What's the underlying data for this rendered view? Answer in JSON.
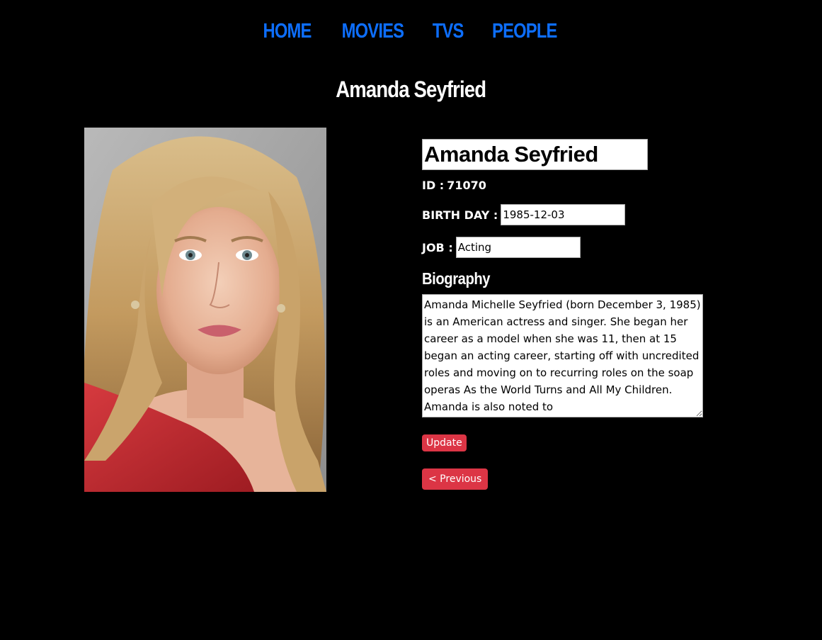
{
  "nav": {
    "items": [
      {
        "label": "HOME"
      },
      {
        "label": "MOVIES"
      },
      {
        "label": "TVS"
      },
      {
        "label": "PEOPLE"
      }
    ],
    "color": "#0d6efd"
  },
  "page_title": "Amanda Seyfried",
  "photo": {
    "alt": "Amanda Seyfried portrait"
  },
  "person": {
    "name": "Amanda Seyfried",
    "id_label": "ID :",
    "id_value": "71070",
    "birthday_label": "BIRTH DAY :",
    "birthday_value": "1985-12-03",
    "job_label": "JOB :",
    "job_value": "Acting",
    "biography_label": "Biography",
    "biography": "Amanda Michelle Seyfried (born December 3, 1985) is an American actress and singer. She began her career as a model when she was 11, then at 15 began an acting career, starting off with uncredited roles and moving on to recurring roles on the soap operas As the World Turns and All My Children. Amanda is also noted to"
  },
  "buttons": {
    "update": "Update",
    "previous": "< Previous",
    "color": "#dc3545"
  }
}
